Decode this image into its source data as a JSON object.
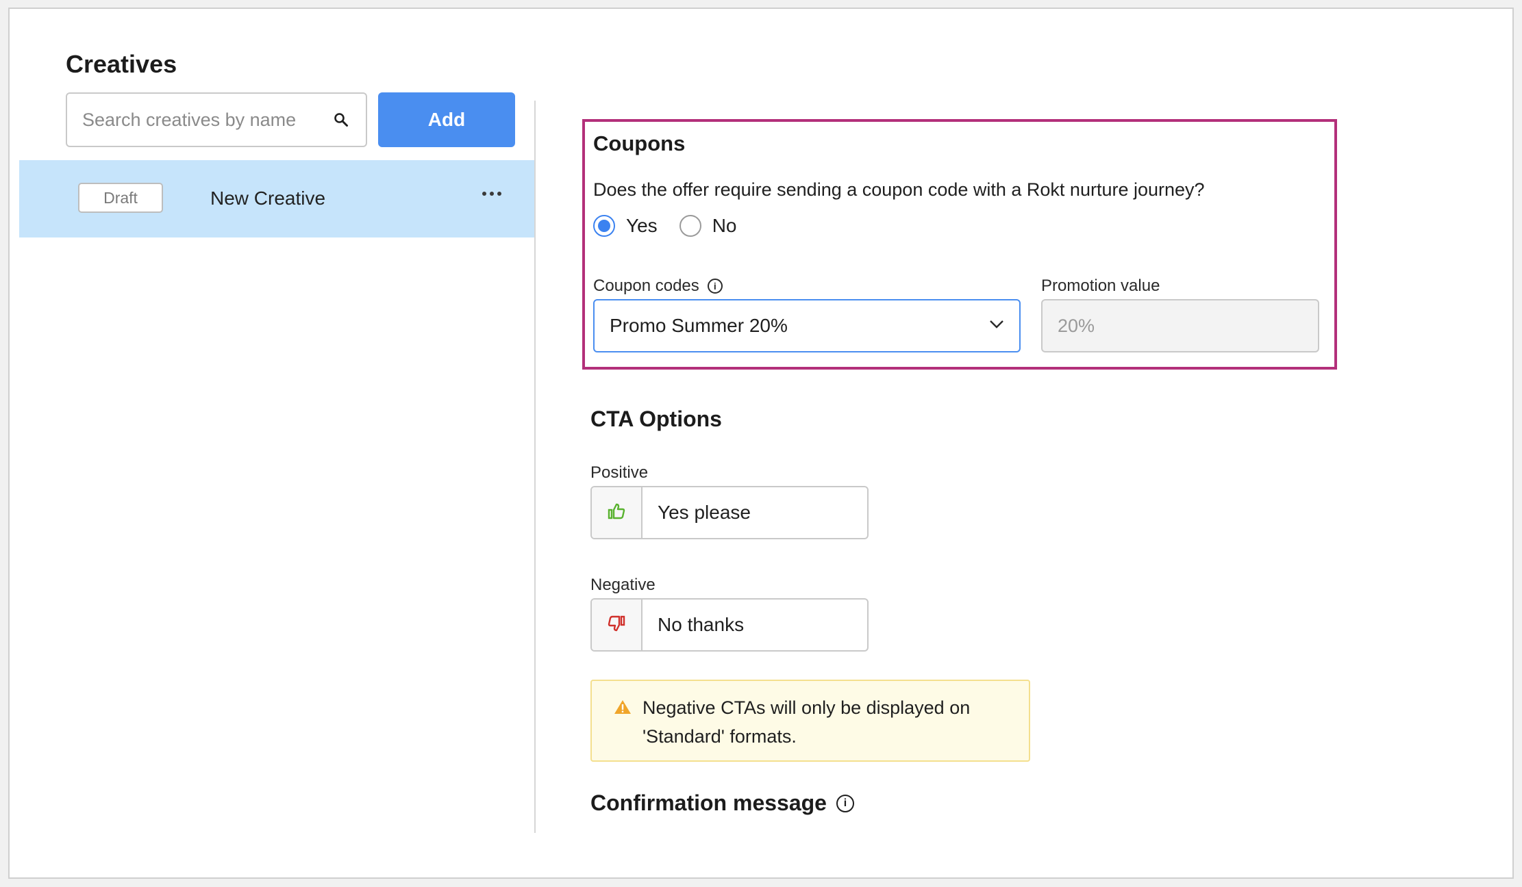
{
  "sidebar": {
    "title": "Creatives",
    "search": {
      "placeholder": "Search creatives by name",
      "value": ""
    },
    "add_label": "Add",
    "items": [
      {
        "status": "Draft",
        "name": "New Creative"
      }
    ]
  },
  "coupons": {
    "title": "Coupons",
    "question": "Does the offer require sending a coupon code with a Rokt nurture journey?",
    "options": [
      {
        "label": "Yes",
        "selected": true
      },
      {
        "label": "No",
        "selected": false
      }
    ],
    "coupon_codes_label": "Coupon codes",
    "coupon_codes_value": "Promo Summer 20%",
    "promotion_value_label": "Promotion value",
    "promotion_value_placeholder": "20%"
  },
  "cta": {
    "title": "CTA Options",
    "positive_label": "Positive",
    "positive_value": "Yes please",
    "negative_label": "Negative",
    "negative_value": "No thanks",
    "warning": "Negative CTAs will only be displayed on 'Standard' formats."
  },
  "confirmation": {
    "title": "Confirmation message"
  },
  "colors": {
    "accent": "#4a8ef0",
    "highlight_border": "#b3307a",
    "selected_row": "#c6e4fb",
    "positive_icon": "#58b22e",
    "negative_icon": "#d0302b",
    "warning_icon": "#f0a52a"
  },
  "icons": {
    "search": "search-icon",
    "more": "ellipsis-icon",
    "info": "info-icon",
    "dropdown": "chevron-down-icon",
    "positive": "thumbs-up-icon",
    "negative": "thumbs-down-icon",
    "warning": "warning-icon"
  }
}
